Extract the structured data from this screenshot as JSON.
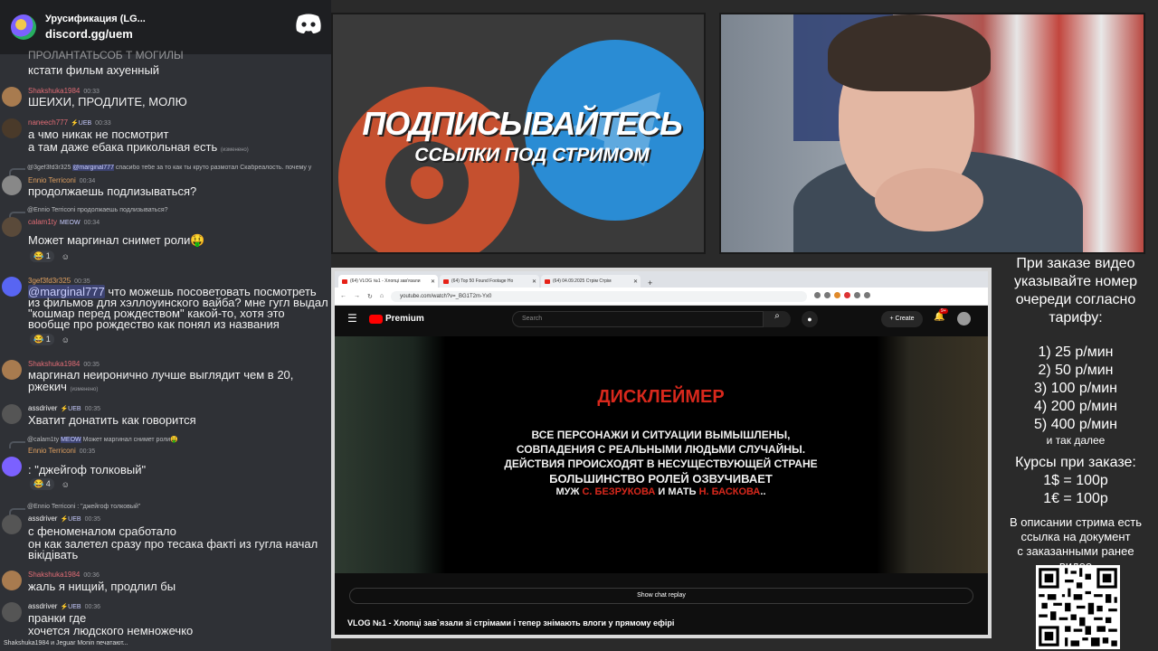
{
  "server": {
    "name": "Урусификация (LG...",
    "link": "discord.gg/uem",
    "partial_line": "ПРОЛАНТАТЬСОБ Т МОГИЛЫ"
  },
  "messages": [
    {
      "id": "m0",
      "text": "кстати фильм ахуенный"
    },
    {
      "id": "m1",
      "user": "Shakshuka1984",
      "time": "00:33",
      "lines": [
        "ШЕИХИ, ПРОДЛИТЕ, МОЛЮ"
      ]
    },
    {
      "id": "m2",
      "user": "naneech777",
      "badge": "⚡UEB",
      "time": "00:33",
      "lines": [
        "а чмо никак не посмотрит",
        "а там даже ебака прикольная есть"
      ],
      "edited": "(изменено)"
    },
    {
      "id": "m3",
      "reply_user": "@3gef3fd3r325",
      "reply_mention": "@marginal777",
      "reply_text": "спасибо тебе за то как ты круто размотал Скабреалость. почему у",
      "user": "Ennio Terriconi",
      "time": "00:34",
      "lines": [
        "продолжаешь подлизываться?"
      ]
    },
    {
      "id": "m4",
      "reply_user": "@Ennio Terriconi",
      "reply_text": "продолжаешь подлизываться?",
      "user": "calam1ty",
      "badge": "MEOW",
      "time": "00:34",
      "lines": [
        "Может маргинал снимет роли🤑"
      ],
      "reactions": [
        "😂 1",
        "☺"
      ]
    },
    {
      "id": "m5",
      "user": "3gef3fd3r325",
      "time": "00:35",
      "mention": "@marginal777",
      "lines": [
        "что можешь посоветовать посмотреть",
        "из фильмов для хэллоуинского вайба? мне гугл выдал",
        "\"кошмар перед рождеством\" какой-то, хотя это",
        "вообще про рождество как понял из названия"
      ],
      "reactions": [
        "😂 1",
        "☺"
      ]
    },
    {
      "id": "m6",
      "user": "Shakshuka1984",
      "time": "00:35",
      "lines": [
        "маргинал неиронично лучше выглядит чем в 20,",
        "ржекич"
      ],
      "edited": "(изменено)"
    },
    {
      "id": "m7",
      "user": "assdriver",
      "badge": "⚡UEB",
      "time": "00:35",
      "lines": [
        "Хватит донатить как говорится"
      ]
    },
    {
      "id": "m8",
      "reply_user": "@calam1ty",
      "reply_mention": "MEOW",
      "reply_text": "Может маргинал снимет роли🤑",
      "user": "Ennio Terriconi",
      "time": "00:35",
      "lines": [
        ": \"джейгоф толковый\""
      ],
      "reactions": [
        "😂 4",
        "☺"
      ]
    },
    {
      "id": "m9",
      "reply_user": "@Ennio Terriconi",
      "reply_text": ": \"джейгоф толковый\"",
      "user": "assdriver",
      "badge": "⚡UEB",
      "time": "00:35",
      "lines": [
        "с феноменалом сработало",
        "он как залетел сразу про тесака факті из гугла начал",
        "вікідівать"
      ]
    },
    {
      "id": "m10",
      "user": "Shakshuka1984",
      "time": "00:36",
      "lines": [
        "жаль я нищий, продлил бы"
      ]
    },
    {
      "id": "m11",
      "user": "assdriver",
      "badge": "⚡UEB",
      "time": "00:36",
      "lines": [
        "пранки где",
        "хочется людского немножечко"
      ]
    }
  ],
  "typing": "Shakshuka1984 и Jeguar Monin печатают...",
  "promo": {
    "title": "ПОДПИСЫВАЙТЕСЬ",
    "subtitle": "ССЫЛКИ ПОД СТРИМОМ"
  },
  "browser": {
    "tabs": [
      "(64) VLOG №1 - Хлопці зав'язали",
      "(64) Top 50 Found Footage Ho",
      "(64) 04.09.2025 Стрім Стрім"
    ],
    "url": "youtube.com/watch?v=_BG1T2m-Yx0",
    "search_placeholder": "Search",
    "logo": "Premium",
    "create": "Create",
    "bell_badge": "9+",
    "show_chat_replay": "Show chat replay",
    "video_title": "VLOG №1 - Хлопці зав`язали зі стрімами і тепер знімають влоги у прямому ефірі"
  },
  "disclaimer": {
    "title": "ДИСКЛЕЙМЕР",
    "lines": [
      "ВСЕ ПЕРСОНАЖИ И СИТУАЦИИ ВЫМЫШЛЕНЫ,",
      "СОВПАДЕНИЯ С РЕАЛЬНЫМИ ЛЮДЬМИ СЛУЧАЙНЫ.",
      "ДЕЙСТВИЯ ПРОИСХОДЯТ В НЕСУЩЕСТВУЮЩЕЙ СТРАНЕ",
      "БОЛЬШИНСТВО РОЛЕЙ ОЗВУЧИВАЕТ"
    ],
    "last": {
      "a": "МУЖ",
      "b": "С. БЕЗРУКОВА",
      "c": "И МАТЬ",
      "d": "Н. БАСКОВА",
      "e": ".."
    }
  },
  "info": {
    "intro": [
      "При заказе видео",
      "указывайте номер",
      "очереди согласно",
      "тарифу:"
    ],
    "tariffs": [
      "1) 25 р/мин",
      "2) 50 р/мин",
      "3) 100 р/мин",
      "4) 200 р/мин",
      "5) 400 р/мин"
    ],
    "etc": "и так далее",
    "rates_title": "Курсы при заказе:",
    "rates": [
      "1$ = 100р",
      "1€ = 100р"
    ],
    "footer": [
      "В описании стрима есть",
      "ссылка на документ",
      "с заказанными ранее",
      "видео"
    ]
  },
  "colors": {
    "username": "#e06c75",
    "chat_bg": "#2f3136",
    "yt_red": "#ff0000",
    "disclaimer_red": "#d8281c"
  }
}
